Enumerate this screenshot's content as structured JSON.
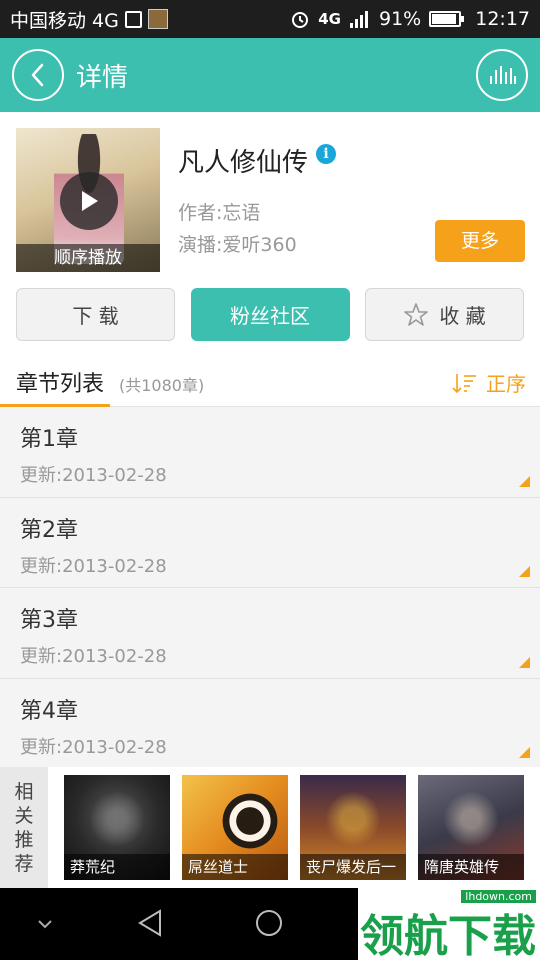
{
  "status_bar": {
    "carrier": "中国移动 4G",
    "network": "4G",
    "battery": "91%",
    "battery_level": 0.91,
    "time": "12:17"
  },
  "header": {
    "title": "详情",
    "back_icon": "back-arrow-icon",
    "right_icon": "equalizer-icon"
  },
  "book": {
    "title": "凡人修仙传",
    "info_badge": "i",
    "author": "作者:忘语",
    "narrator": "演播:爱听360",
    "cover_caption": "顺序播放",
    "more_label": "更多"
  },
  "actions": {
    "download": "下 载",
    "community": "粉丝社区",
    "favorite": "收 藏"
  },
  "chapters": {
    "title": "章节列表",
    "count": "(共1080章)",
    "sort_label": "正序",
    "items": [
      {
        "name": "第1章",
        "date": "更新:2013-02-28"
      },
      {
        "name": "第2章",
        "date": "更新:2013-02-28"
      },
      {
        "name": "第3章",
        "date": "更新:2013-02-28"
      },
      {
        "name": "第4章",
        "date": "更新:2013-02-28"
      }
    ]
  },
  "recommendations": {
    "label": [
      "相",
      "关",
      "推",
      "荐"
    ],
    "items": [
      {
        "title": "莽荒纪"
      },
      {
        "title": "屌丝道士"
      },
      {
        "title": "丧尸爆发后一"
      },
      {
        "title": "隋唐英雄传"
      }
    ]
  },
  "watermark": {
    "text": "领航下载",
    "url": "lhdown.com"
  },
  "colors": {
    "accent": "#3dbfb0",
    "orange": "#f5a21a",
    "info_blue": "#18a7d8"
  }
}
